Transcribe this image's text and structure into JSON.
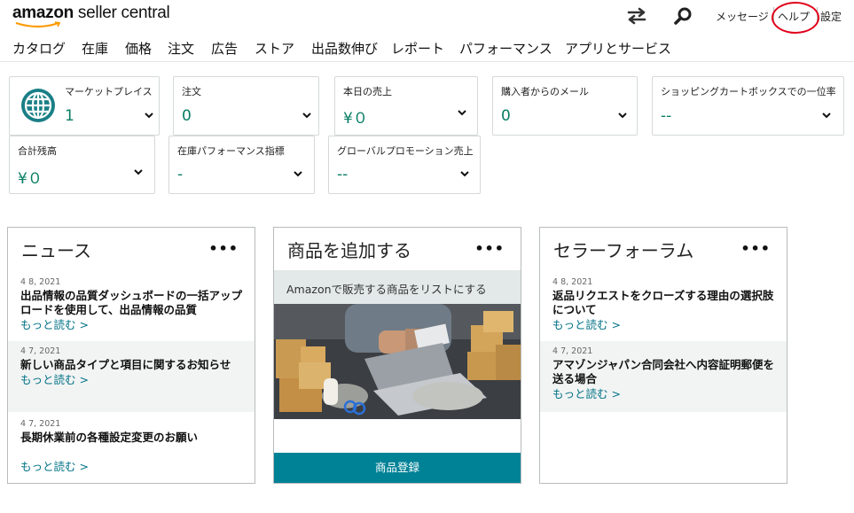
{
  "header": {
    "logo_brand": "amazon",
    "logo_product": " seller central",
    "links": {
      "messages": "メッセージ",
      "help": "ヘルプ",
      "settings": "設定"
    },
    "accent_ring_color": "#e0001a"
  },
  "nav": [
    "カタログ",
    "在庫",
    "価格",
    "注文",
    "広告",
    "ストア",
    "出品数伸び",
    "レポート",
    "パフォーマンス",
    "アプリとサービス"
  ],
  "tiles": [
    {
      "label": "マーケットプレイス",
      "value": "1",
      "icon": "globe-icon"
    },
    {
      "label": "注文",
      "value": "0"
    },
    {
      "label": "本日の売上",
      "value": "¥０"
    },
    {
      "label": "購入者からのメール",
      "value": "0"
    },
    {
      "label": "ショッピングカートボックスでの一位率",
      "value": "--"
    },
    {
      "label": "合計残高",
      "value": "¥０"
    },
    {
      "label": "在庫パフォーマンス指標",
      "value": "-"
    },
    {
      "label": "グローバルプロモーション売上",
      "value": "--"
    }
  ],
  "cards": {
    "news": {
      "title": "ニュース",
      "more": "•••",
      "items": [
        {
          "date": "4 8, 2021",
          "title": "出品情報の品質ダッシュボードの一括アップロードを使用して、出品情報の品質",
          "link": "もっと読む >"
        },
        {
          "date": "4 7, 2021",
          "title": "新しい商品タイプと項目に関するお知らせ",
          "link": "もっと読む >"
        },
        {
          "date": "4 7, 2021",
          "title": "長期休業前の各種設定変更のお願い",
          "link": "もっと読む >"
        }
      ]
    },
    "add_product": {
      "title": "商品を追加する",
      "more": "•••",
      "banner": "Amazonで販売する商品をリストにする",
      "button": "商品登録"
    },
    "forum": {
      "title": "セラーフォーラム",
      "more": "•••",
      "items": [
        {
          "date": "4 8, 2021",
          "title": "返品リクエストをクローズする理由の選択肢について",
          "link": "もっと読む >"
        },
        {
          "date": "4 7, 2021",
          "title": "アマゾンジャパン合同会社へ内容証明郵便を送る場合",
          "link": "もっと読む >"
        }
      ]
    }
  },
  "colors": {
    "value_green": "#067d62",
    "link_teal": "#007185",
    "button_teal": "#008296"
  }
}
